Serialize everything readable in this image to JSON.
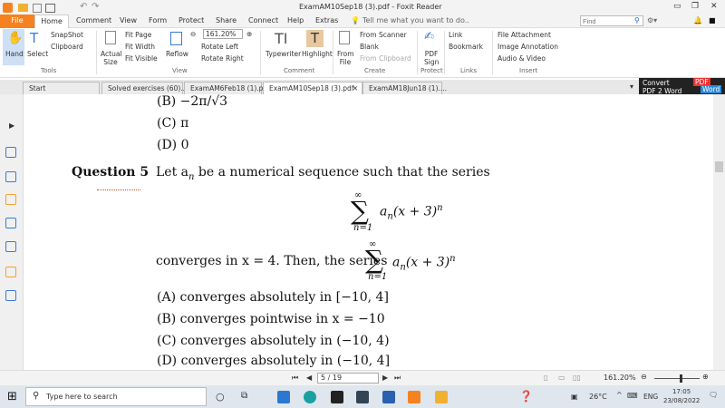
{
  "window": {
    "title": "ExamAM10Sep18 (3).pdf - Foxit Reader"
  },
  "menu": {
    "file": "File",
    "home": "Home",
    "items": [
      "Comment",
      "View",
      "Form",
      "Protect",
      "Share",
      "Connect",
      "Help",
      "Extras"
    ],
    "tell": "Tell me what you want to do..",
    "find_placeholder": "Find"
  },
  "ribbon": {
    "hand": "Hand",
    "select": "Select",
    "snapshot": "SnapShot",
    "clipboard": "Clipboard",
    "tools": "Tools",
    "actual_size": "Actual Size",
    "fit_page": "Fit Page",
    "fit_width": "Fit Width",
    "fit_visible": "Fit Visible",
    "reflow": "Reflow",
    "zoom": "161.20%",
    "rotate_left": "Rotate Left",
    "rotate_right": "Rotate Right",
    "view": "View",
    "typewriter": "Typewriter",
    "highlight": "Highlight",
    "comment": "Comment",
    "from_file": "From File",
    "from_scanner": "From Scanner",
    "blank": "Blank",
    "from_clipboard": "From Clipboard",
    "create": "Create",
    "pdf_sign": "PDF Sign",
    "protect": "Protect",
    "link": "Link",
    "bookmark": "Bookmark",
    "links": "Links",
    "file_attachment": "File Attachment",
    "image_annotation": "Image Annotation",
    "audio_video": "Audio & Video",
    "insert": "Insert"
  },
  "tabs": [
    "Start",
    "Solved exercises (60)....",
    "ExamAM6Feb18 (1).pdf",
    "ExamAM10Sep18 (3).pdf",
    "ExamAM18Jun18 (1)...."
  ],
  "convert": {
    "line1": "Convert",
    "line2": "PDF 2 Word",
    "pdf": "PDF",
    "word": "Word"
  },
  "doc": {
    "b_prev": "(B)  −2π/√3",
    "c_prev": "(C)  π",
    "d_prev": "(D)  0",
    "q_label": "Question 5",
    "q_text": "Let a",
    "q_text2": " be a numerical sequence such that the series",
    "series": "a",
    "series2": "(x + 3)",
    "conv1": "converges in x = 4. Then, the series",
    "opts": [
      "(A)  converges absolutely in [−10, 4]",
      "(B)  converges pointwise in x = −10",
      "(C)  converges absolutely in (−10, 4)",
      "(D)  converges absolutely in (−10, 4]"
    ]
  },
  "status": {
    "page": "5 / 19",
    "zoom": "161.20%"
  },
  "taskbar": {
    "search": "Type here to search",
    "weather": "26°C",
    "lang": "ENG",
    "time": "17:05",
    "date": "23/08/2022"
  }
}
